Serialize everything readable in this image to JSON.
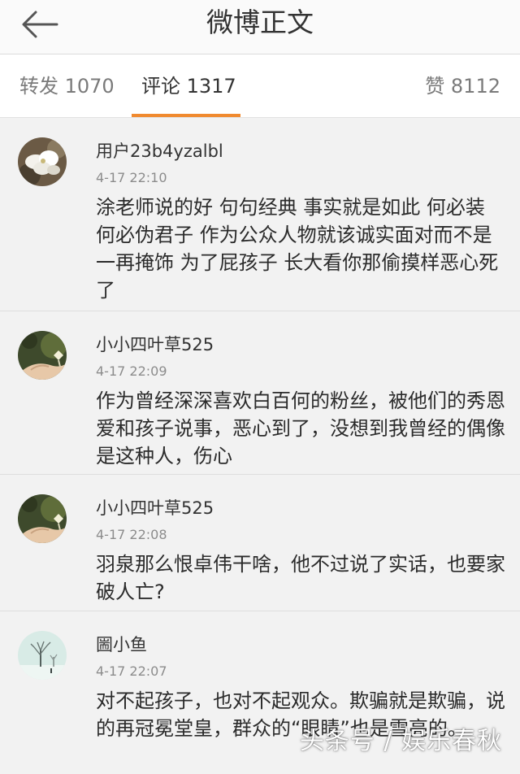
{
  "header": {
    "title": "微博正文",
    "back_icon": "arrow-left-icon"
  },
  "tabs": {
    "repost": "转发 1070",
    "comments": "评论 1317",
    "likes": "赞 8112",
    "active": "comments",
    "accent_color": "#f08a2f"
  },
  "comments": [
    {
      "username": "用户23b4yzalbl",
      "time": "4-17 22:10",
      "text": "涂老师说的好 句句经典 事实就是如此 何必装 何必伪君子  作为公众人物就该诚实面对而不是一再掩饰  为了屁孩子  长大看你那偷摸样恶心死了",
      "avatar_icon": "flower-avatar-icon"
    },
    {
      "username": "小小四叶草525",
      "time": "4-17 22:09",
      "text": "作为曾经深深喜欢白百何的粉丝，被他们的秀恩爱和孩子说事，恶心到了，没想到我曾经的偶像是这种人，伤心",
      "avatar_icon": "hand-clover-avatar-icon"
    },
    {
      "username": "小小四叶草525",
      "time": "4-17 22:08",
      "text": "羽泉那么恨卓伟干啥，他不过说了实话，也要家破人亡?",
      "avatar_icon": "hand-clover-avatar-icon"
    },
    {
      "username": "圌小鱼",
      "time": "4-17 22:07",
      "text": "对不起孩子，也对不起观众。欺骗就是欺骗，说的再冠冕堂皇，群众的“眼睛”也是雪亮的。",
      "avatar_icon": "winter-tree-avatar-icon"
    }
  ],
  "watermark": "头条号 / 娱乐春秋"
}
